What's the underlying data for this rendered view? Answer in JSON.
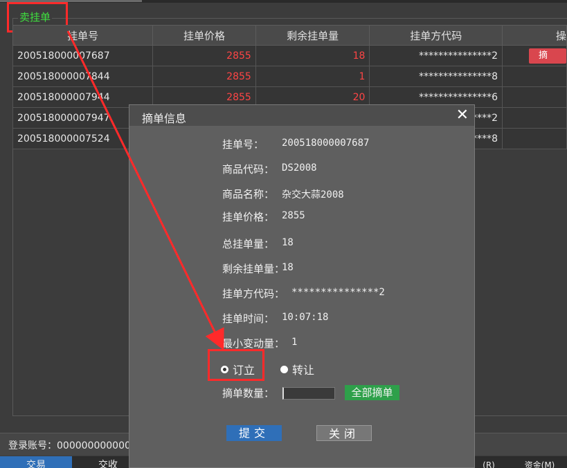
{
  "section": {
    "title": "卖挂单"
  },
  "table": {
    "headers": [
      "挂单号",
      "挂单价格",
      "剩余挂单量",
      "挂单方代码",
      "操"
    ],
    "rows": [
      {
        "id": "200518000007687",
        "price": "2855",
        "remain": "18",
        "code": "***************2",
        "op": "摘"
      },
      {
        "id": "200518000007844",
        "price": "2855",
        "remain": "1",
        "code": "***************8",
        "op": ""
      },
      {
        "id": "200518000007944",
        "price": "2855",
        "remain": "20",
        "code": "***************6",
        "op": ""
      },
      {
        "id": "200518000007947",
        "price": "",
        "remain": "",
        "code": "*******2",
        "op": ""
      },
      {
        "id": "200518000007524",
        "price": "",
        "remain": "",
        "code": "*******8",
        "op": ""
      }
    ]
  },
  "footer": {
    "login_label": "登录账号：000000000000",
    "tabs": [
      "交易",
      "交收",
      "(R)",
      "资金(M)"
    ]
  },
  "dialog": {
    "title": "摘单信息",
    "close_glyph": "✕",
    "fields": [
      {
        "label": "挂单号：",
        "value": "200518000007687"
      },
      {
        "label": "商品代码：",
        "value": "DS2008"
      },
      {
        "label": "商品名称：",
        "value": "杂交大蒜2008"
      },
      {
        "label": "挂单价格：",
        "value": "2855"
      },
      {
        "label": "总挂单量：",
        "value": "18"
      },
      {
        "label": "剩余挂单量：",
        "value": "18"
      },
      {
        "label": "挂单方代码：",
        "value": "***************2"
      },
      {
        "label": "挂单时间：",
        "value": "10:07:18"
      },
      {
        "label": "最小变动量：",
        "value": "1"
      }
    ],
    "radio_options": [
      "订立",
      "转让"
    ],
    "selected_option": "订立",
    "qty_label": "摘单数量：",
    "qty_value": "",
    "all_button": "全部摘单",
    "submit_button": "提交",
    "close_button": "关闭"
  },
  "colors": {
    "accent_green": "#3fe03f",
    "price_red": "#ff4545",
    "annotation_red": "#ff2a2a",
    "submit_blue": "#2f6fb8"
  }
}
